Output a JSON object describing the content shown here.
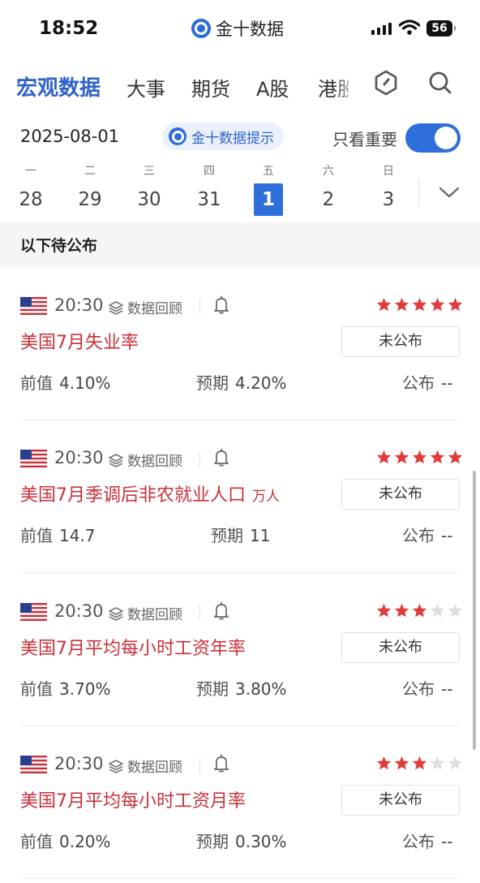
{
  "status_bar": {
    "time": "18:52",
    "app_name": "金十数据",
    "battery": "56"
  },
  "nav_tabs": [
    {
      "label": "宏观数据",
      "active": true
    },
    {
      "label": "大事"
    },
    {
      "label": "期货"
    },
    {
      "label": "A股"
    },
    {
      "label": "港股"
    }
  ],
  "icons": {
    "tab_extra": "hexagon-icon",
    "search": "search-icon"
  },
  "date_bar": {
    "date": "2025-08-01",
    "promo_label": "金十数据提示",
    "important_only_label": "只看重要",
    "important_only_on": true
  },
  "week": [
    {
      "weekday": "一",
      "day": "28"
    },
    {
      "weekday": "二",
      "day": "29"
    },
    {
      "weekday": "三",
      "day": "30"
    },
    {
      "weekday": "四",
      "day": "31"
    },
    {
      "weekday": "五",
      "day": "1",
      "selected": true
    },
    {
      "weekday": "六",
      "day": "2"
    },
    {
      "weekday": "日",
      "day": "3"
    }
  ],
  "section_header": "以下待公布",
  "colors": {
    "accent": "#2f6fdc",
    "title_red": "#c8303a",
    "star_on": "#e23b3b",
    "star_off": "#dedede"
  },
  "events": [
    {
      "time": "20:30",
      "review_label": "数据回顾",
      "stars": 5,
      "title": "美国7月失业率",
      "unit": "",
      "status": "未公布",
      "prev_label": "前值",
      "prev_value": "4.10%",
      "forecast_label": "预期",
      "forecast_value": "4.20%",
      "actual_label": "公布",
      "actual_value": "--"
    },
    {
      "time": "20:30",
      "review_label": "数据回顾",
      "stars": 5,
      "title": "美国7月季调后非农就业人口",
      "unit": "万人",
      "status": "未公布",
      "prev_label": "前值",
      "prev_value": "14.7",
      "forecast_label": "预期",
      "forecast_value": "11",
      "actual_label": "公布",
      "actual_value": "--"
    },
    {
      "time": "20:30",
      "review_label": "数据回顾",
      "stars": 3,
      "title": "美国7月平均每小时工资年率",
      "unit": "",
      "status": "未公布",
      "prev_label": "前值",
      "prev_value": "3.70%",
      "forecast_label": "预期",
      "forecast_value": "3.80%",
      "actual_label": "公布",
      "actual_value": "--"
    },
    {
      "time": "20:30",
      "review_label": "数据回顾",
      "stars": 3,
      "title": "美国7月平均每小时工资月率",
      "unit": "",
      "status": "未公布",
      "prev_label": "前值",
      "prev_value": "0.20%",
      "forecast_label": "预期",
      "forecast_value": "0.30%",
      "actual_label": "公布",
      "actual_value": "--"
    }
  ]
}
